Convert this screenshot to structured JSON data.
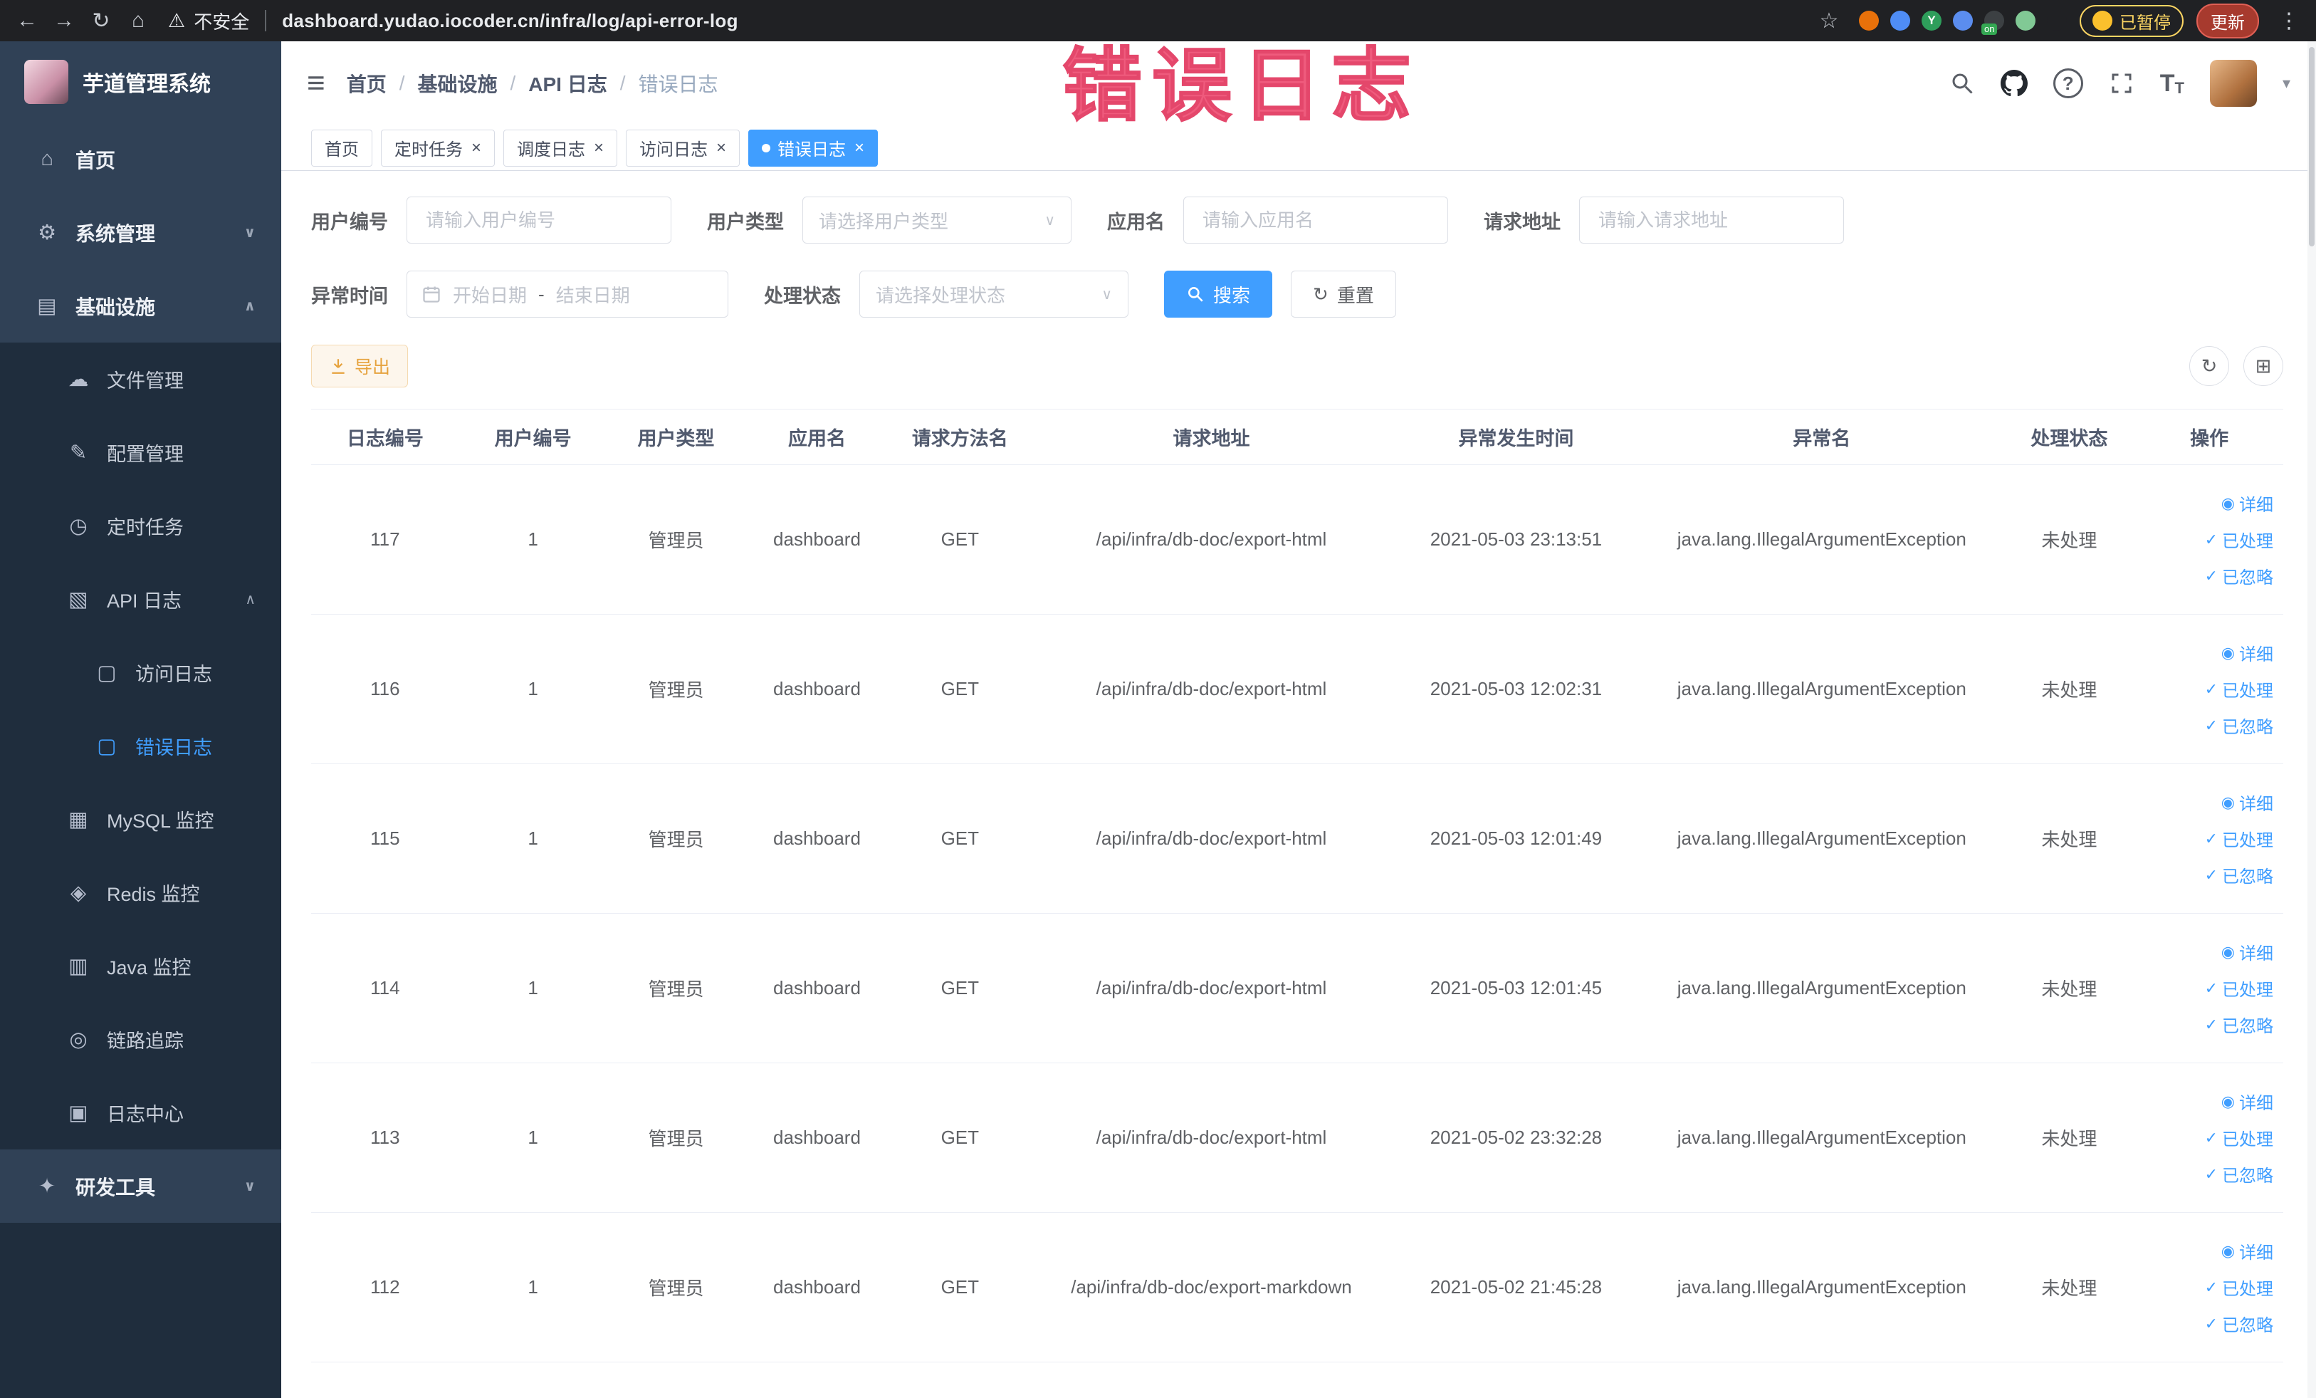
{
  "browser": {
    "security_label": "不安全",
    "url": "dashboard.yudao.iocoder.cn/infra/log/api-error-log",
    "paused_badge": "已暂停",
    "update_label": "更新",
    "extensions": [
      {
        "name": "extension-orange",
        "color": "#e8710a"
      },
      {
        "name": "extension-blue-drop",
        "color": "#4f8df5"
      },
      {
        "name": "extension-green-y",
        "color": "#2e9e5b",
        "letter": "Y"
      },
      {
        "name": "extension-grid",
        "color": "#5b8def"
      },
      {
        "name": "extension-dark",
        "color": "#3c4043",
        "badge": "on"
      },
      {
        "name": "extension-leaf",
        "color": "#81c995"
      },
      {
        "name": "extension-puzzle",
        "color": "#202124"
      }
    ]
  },
  "overlay_title": "错误日志",
  "icons": {
    "back": "←",
    "forward": "→",
    "reload": "↻",
    "home": "⌂",
    "warning": "⚠",
    "star": "☆",
    "more_vertical": "⋮",
    "hamburger": "≡",
    "breadcrumb_sep": "/",
    "question": "?",
    "caret_down": "▾",
    "chevron_down": "∨",
    "chevron_up": "∧",
    "close": "×",
    "select_caret": "∨",
    "refresh": "↻",
    "grid": "⊞",
    "eye": "◉",
    "check": "✓",
    "font_size_large": "T",
    "font_size_small": "T",
    "home-icon": "⌂",
    "gear-icon": "⚙",
    "infra-icon": "▤",
    "file-icon": "☁",
    "config-icon": "✎",
    "timer-icon": "◷",
    "api-log-icon": "▧",
    "access-log-icon": "▢",
    "error-log-icon": "▢",
    "mysql-icon": "▦",
    "redis-icon": "◈",
    "java-icon": "▥",
    "trace-icon": "◎",
    "log-center-icon": "▣",
    "devtools-icon": "✦"
  },
  "sidebar": {
    "logo_title": "芋道管理系统",
    "items": [
      {
        "label": "首页",
        "icon": "home-icon",
        "level": 1
      },
      {
        "label": "系统管理",
        "icon": "gear-icon",
        "level": 1,
        "chevron": "down"
      },
      {
        "label": "基础设施",
        "icon": "infra-icon",
        "level": 1,
        "chevron": "up"
      },
      {
        "label": "文件管理",
        "icon": "file-icon",
        "level": 2
      },
      {
        "label": "配置管理",
        "icon": "config-icon",
        "level": 2
      },
      {
        "label": "定时任务",
        "icon": "timer-icon",
        "level": 2
      },
      {
        "label": "API 日志",
        "icon": "api-log-icon",
        "level": 2,
        "chevron": "up"
      },
      {
        "label": "访问日志",
        "icon": "access-log-icon",
        "level": 3
      },
      {
        "label": "错误日志",
        "icon": "error-log-icon",
        "level": 3,
        "active": true
      },
      {
        "label": "MySQL 监控",
        "icon": "mysql-icon",
        "level": 2
      },
      {
        "label": "Redis 监控",
        "icon": "redis-icon",
        "level": 2
      },
      {
        "label": "Java 监控",
        "icon": "java-icon",
        "level": 2
      },
      {
        "label": "链路追踪",
        "icon": "trace-icon",
        "level": 2
      },
      {
        "label": "日志中心",
        "icon": "log-center-icon",
        "level": 2
      },
      {
        "label": "研发工具",
        "icon": "devtools-icon",
        "level": 1,
        "chevron": "down"
      }
    ]
  },
  "header": {
    "breadcrumb": [
      "首页",
      "基础设施",
      "API 日志",
      "错误日志"
    ]
  },
  "tabs": [
    {
      "label": "首页",
      "closable": false,
      "active": false
    },
    {
      "label": "定时任务",
      "closable": true,
      "active": false
    },
    {
      "label": "调度日志",
      "closable": true,
      "active": false
    },
    {
      "label": "访问日志",
      "closable": true,
      "active": false
    },
    {
      "label": "错误日志",
      "closable": true,
      "active": true
    }
  ],
  "filters": {
    "user_id": {
      "label": "用户编号",
      "placeholder": "请输入用户编号"
    },
    "user_type": {
      "label": "用户类型",
      "placeholder": "请选择用户类型"
    },
    "app_name": {
      "label": "应用名",
      "placeholder": "请输入应用名"
    },
    "request_url": {
      "label": "请求地址",
      "placeholder": "请输入请求地址"
    },
    "exception_time": {
      "label": "异常时间",
      "start_placeholder": "开始日期",
      "separator": "-",
      "end_placeholder": "结束日期"
    },
    "process_status": {
      "label": "处理状态",
      "placeholder": "请选择处理状态"
    },
    "search_button": "搜索",
    "reset_button": "重置"
  },
  "toolbar": {
    "export_button": "导出"
  },
  "table": {
    "columns": [
      "日志编号",
      "用户编号",
      "用户类型",
      "应用名",
      "请求方法名",
      "请求地址",
      "异常发生时间",
      "异常名",
      "处理状态",
      "操作"
    ],
    "column_keys": [
      "log-id",
      "user-id",
      "user-type",
      "app-name",
      "method",
      "request-url",
      "error-time",
      "exception-name",
      "status"
    ],
    "actions": [
      {
        "name": "detail-link",
        "icon": "eye",
        "label": "详细"
      },
      {
        "name": "processed-link",
        "icon": "check",
        "label": "已处理"
      },
      {
        "name": "ignored-link",
        "icon": "check",
        "label": "已忽略"
      }
    ],
    "rows": [
      [
        "117",
        "1",
        "管理员",
        "dashboard",
        "GET",
        "/api/infra/db-doc/export-html",
        "2021-05-03 23:13:51",
        "java.lang.IllegalArgumentException",
        "未处理"
      ],
      [
        "116",
        "1",
        "管理员",
        "dashboard",
        "GET",
        "/api/infra/db-doc/export-html",
        "2021-05-03 12:02:31",
        "java.lang.IllegalArgumentException",
        "未处理"
      ],
      [
        "115",
        "1",
        "管理员",
        "dashboard",
        "GET",
        "/api/infra/db-doc/export-html",
        "2021-05-03 12:01:49",
        "java.lang.IllegalArgumentException",
        "未处理"
      ],
      [
        "114",
        "1",
        "管理员",
        "dashboard",
        "GET",
        "/api/infra/db-doc/export-html",
        "2021-05-03 12:01:45",
        "java.lang.IllegalArgumentException",
        "未处理"
      ],
      [
        "113",
        "1",
        "管理员",
        "dashboard",
        "GET",
        "/api/infra/db-doc/export-html",
        "2021-05-02 23:32:28",
        "java.lang.IllegalArgumentException",
        "未处理"
      ],
      [
        "112",
        "1",
        "管理员",
        "dashboard",
        "GET",
        "/api/infra/db-doc/export-markdown",
        "2021-05-02 21:45:28",
        "java.lang.IllegalArgumentException",
        "未处理"
      ]
    ]
  },
  "accent_colors": {
    "primary_blue": "#409eff",
    "sidebar_bg": "#304156",
    "submenu_bg": "#1f2d3d",
    "warning_orange": "#e6a23c",
    "annotation_pink": "#ef5b7d"
  }
}
